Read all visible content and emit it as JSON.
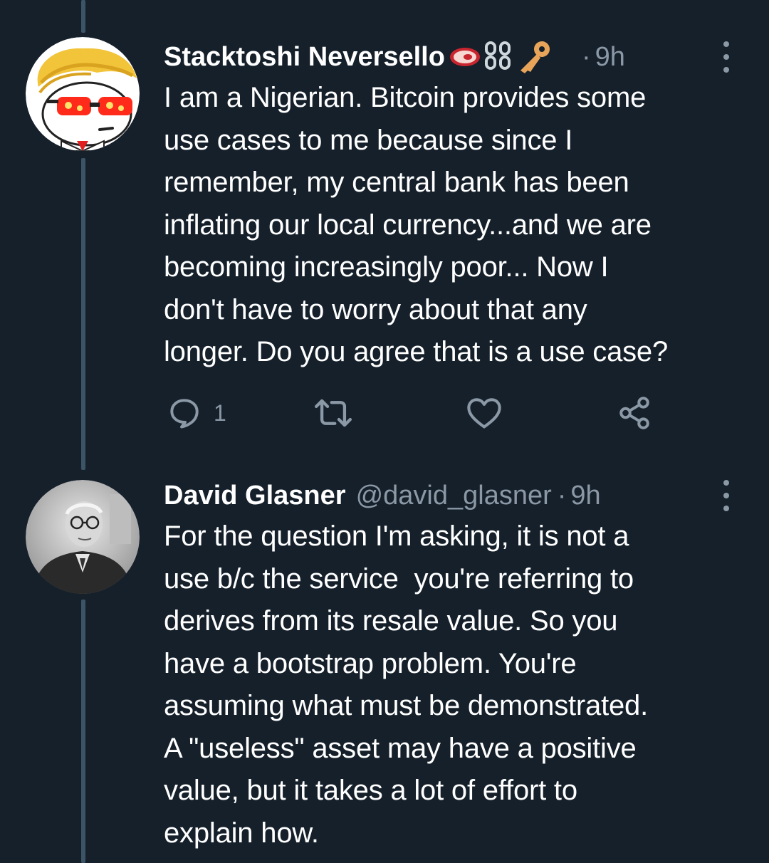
{
  "tweets": [
    {
      "display_name": "Stacktoshi Neversello",
      "badges": [
        "steak-emoji-icon",
        "chain-emoji-icon",
        "key-emoji-icon"
      ],
      "dot": "·",
      "timestamp": "9h",
      "text": "I am a Nigerian. Bitcoin provides some\nuse cases to me because since I\nremember, my central bank has been\ninflating our local currency...and we are\nbecoming increasingly poor... Now I\ndon't have to worry about that any\nlonger. Do you agree that is a use case?",
      "actions": {
        "reply_count": "1",
        "retweet_count": "",
        "like_count": ""
      }
    },
    {
      "display_name": "David Glasner",
      "handle": "@david_glasner",
      "dot": "·",
      "timestamp": "9h",
      "text": "For the question I'm asking, it is not a\nuse b/c the service  you're referring to\nderives from its resale value. So you\nhave a bootstrap problem. You're\nassuming what must be demonstrated.\nA \"useless\" asset may have a positive\nvalue, but it takes a lot of effort to\nexplain how."
    }
  ],
  "colors": {
    "background": "#15202b",
    "secondary_text": "#8b98a5",
    "thread_line": "#3d5466"
  }
}
